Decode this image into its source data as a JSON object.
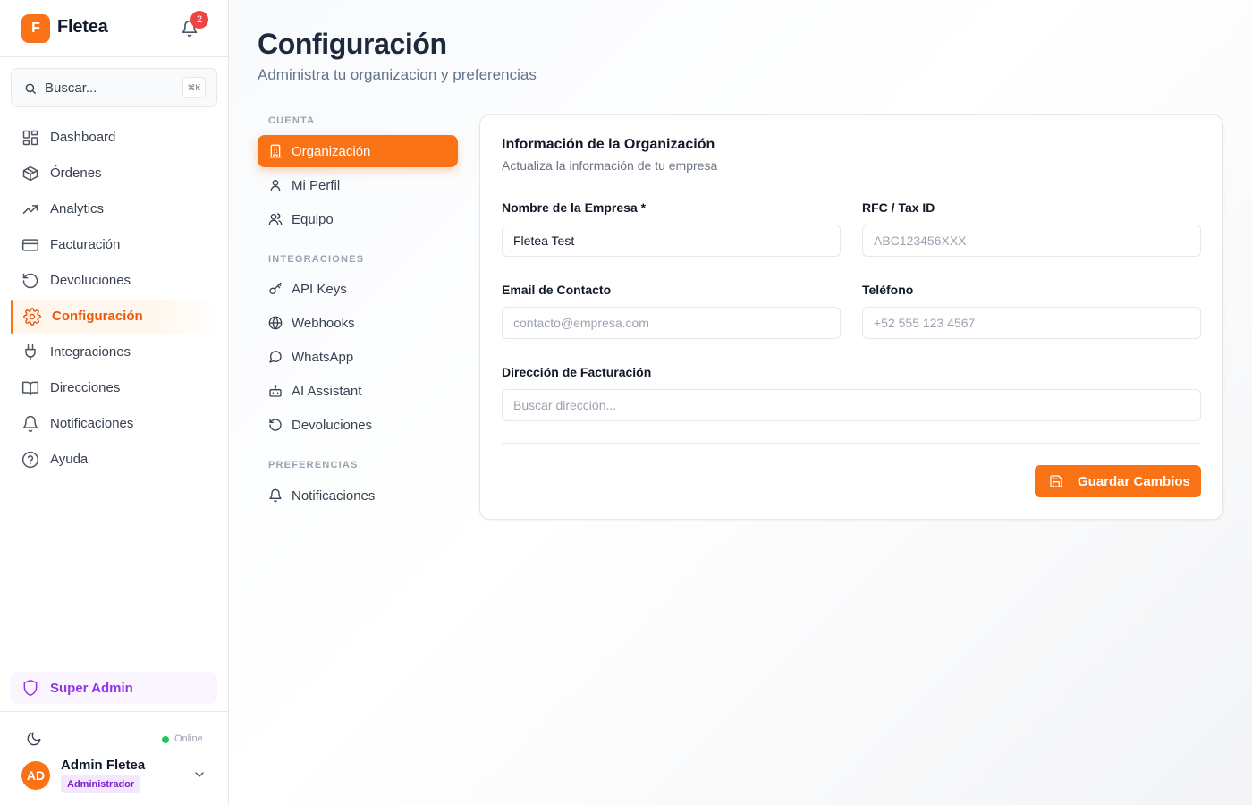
{
  "brand": {
    "logo_letter": "F",
    "name": "Fletea"
  },
  "notifications": {
    "count": "2"
  },
  "search": {
    "placeholder": "Buscar...",
    "shortcut": "⌘K"
  },
  "sidebar": {
    "items": [
      {
        "label": "Dashboard",
        "icon": "dashboard-icon"
      },
      {
        "label": "Órdenes",
        "icon": "box-icon"
      },
      {
        "label": "Analytics",
        "icon": "trending-up-icon"
      },
      {
        "label": "Facturación",
        "icon": "credit-card-icon"
      },
      {
        "label": "Devoluciones",
        "icon": "rotate-ccw-icon"
      },
      {
        "label": "Configuración",
        "icon": "gear-icon",
        "active": true
      },
      {
        "label": "Integraciones",
        "icon": "plug-icon"
      },
      {
        "label": "Direcciones",
        "icon": "book-icon"
      },
      {
        "label": "Notificaciones",
        "icon": "bell-icon"
      },
      {
        "label": "Ayuda",
        "icon": "help-circle-icon"
      }
    ],
    "super_admin": "Super Admin"
  },
  "status": {
    "online": "Online"
  },
  "user": {
    "initials": "AD",
    "name": "Admin Fletea",
    "role": "Administrador"
  },
  "page": {
    "title": "Configuración",
    "subtitle": "Administra tu organizacion y preferencias"
  },
  "settings_nav": {
    "sections": [
      {
        "label": "CUENTA",
        "items": [
          {
            "label": "Organización",
            "icon": "building-icon",
            "active": true
          },
          {
            "label": "Mi Perfil",
            "icon": "user-icon"
          },
          {
            "label": "Equipo",
            "icon": "users-icon"
          }
        ]
      },
      {
        "label": "INTEGRACIONES",
        "items": [
          {
            "label": "API Keys",
            "icon": "key-icon"
          },
          {
            "label": "Webhooks",
            "icon": "globe-icon"
          },
          {
            "label": "WhatsApp",
            "icon": "message-circle-icon"
          },
          {
            "label": "AI Assistant",
            "icon": "bot-icon"
          },
          {
            "label": "Devoluciones",
            "icon": "rotate-ccw-icon"
          }
        ]
      },
      {
        "label": "PREFERENCIAS",
        "items": [
          {
            "label": "Notificaciones",
            "icon": "bell-icon"
          }
        ]
      }
    ]
  },
  "org_card": {
    "title": "Información de la Organización",
    "subtitle": "Actualiza la información de tu empresa",
    "fields": {
      "company_name": {
        "label": "Nombre de la Empresa *",
        "value": "Fletea Test",
        "placeholder": ""
      },
      "tax_id": {
        "label": "RFC / Tax ID",
        "value": "",
        "placeholder": "ABC123456XXX"
      },
      "email": {
        "label": "Email de Contacto",
        "value": "",
        "placeholder": "contacto@empresa.com"
      },
      "phone": {
        "label": "Teléfono",
        "value": "",
        "placeholder": "+52 555 123 4567"
      },
      "address": {
        "label": "Dirección de Facturación",
        "value": "",
        "placeholder": "Buscar dirección..."
      }
    },
    "save_label": "Guardar Cambios"
  },
  "colors": {
    "accent": "#f97316",
    "purple": "#9333ea",
    "online": "#22c55e",
    "badge": "#ef4444"
  }
}
